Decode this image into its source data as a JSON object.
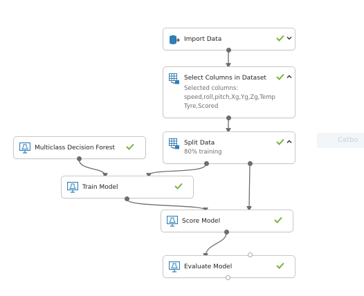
{
  "modules": {
    "import_data": {
      "title": "Import Data",
      "status": "complete",
      "expanded": false
    },
    "select_columns": {
      "title": "Select Columns in Dataset",
      "status": "complete",
      "expanded": true,
      "detail_line1": "Selected columns:",
      "detail_line2": "speed,roll,pitch,Xg,Yg,Zg,Temp",
      "detail_line3": "Tyre,Scored"
    },
    "split_data": {
      "title": "Split Data",
      "status": "complete",
      "expanded": true,
      "detail": "80% training"
    },
    "multiclass_decision_forest": {
      "title": "Multiclass Decision Forest",
      "status": "complete"
    },
    "train_model": {
      "title": "Train Model",
      "status": "complete"
    },
    "score_model": {
      "title": "Score Model",
      "status": "complete"
    },
    "evaluate_model": {
      "title": "Evaluate Model",
      "status": "complete"
    }
  },
  "partial_label": "Catbo",
  "colors": {
    "check": "#7ab23c",
    "icon_blue": "#2f7fb8",
    "connector": "#6d6d6d",
    "border": "#c8c8c8"
  },
  "icons": {
    "import_data": "database-arrow-icon",
    "select_columns": "table-grid-icon",
    "split_data": "table-grid-icon",
    "learner": "monitor-flask-icon"
  }
}
